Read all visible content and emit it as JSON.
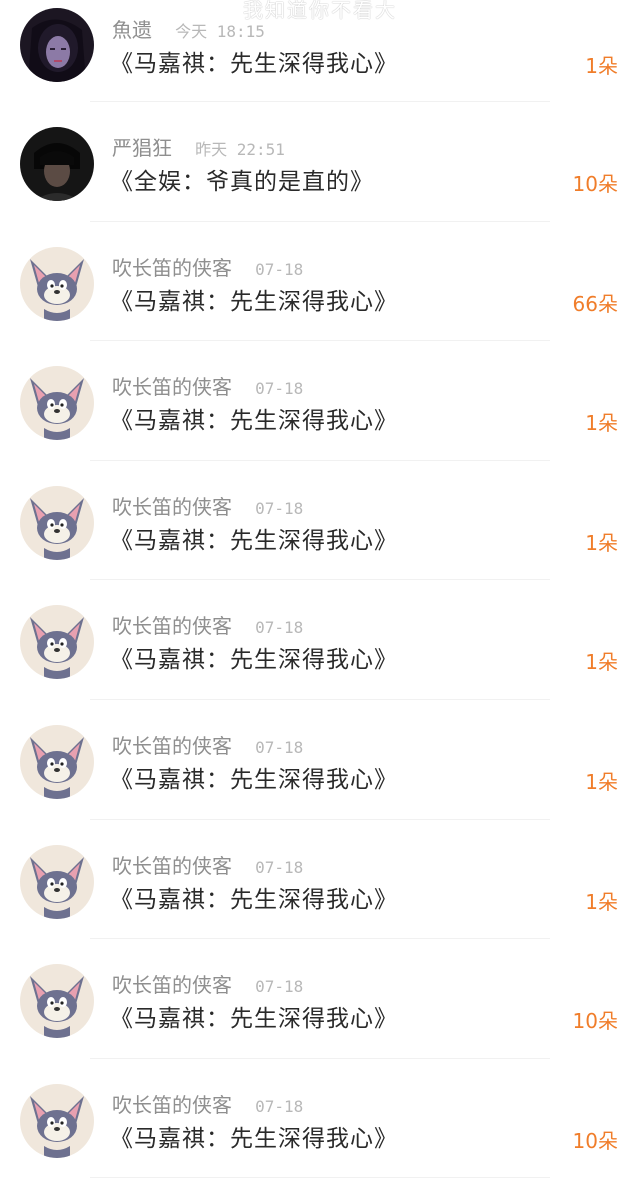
{
  "watermark": "我知道你不看大",
  "flower_unit": "朵",
  "items": [
    {
      "user": "魚遗",
      "time": "今天 18:15",
      "title": "《马嘉祺：先生深得我心》",
      "count": "1",
      "avatar": "dark-portrait-purple"
    },
    {
      "user": "严猖狂",
      "time": "昨天 22:51",
      "title": "《全娱：爷真的是直的》",
      "count": "10",
      "avatar": "dark-portrait"
    },
    {
      "user": "吹长笛的侠客",
      "time": "07-18",
      "title": "《马嘉祺：先生深得我心》",
      "count": "66",
      "avatar": "cartoon-cat"
    },
    {
      "user": "吹长笛的侠客",
      "time": "07-18",
      "title": "《马嘉祺：先生深得我心》",
      "count": "1",
      "avatar": "cartoon-cat"
    },
    {
      "user": "吹长笛的侠客",
      "time": "07-18",
      "title": "《马嘉祺：先生深得我心》",
      "count": "1",
      "avatar": "cartoon-cat"
    },
    {
      "user": "吹长笛的侠客",
      "time": "07-18",
      "title": "《马嘉祺：先生深得我心》",
      "count": "1",
      "avatar": "cartoon-cat"
    },
    {
      "user": "吹长笛的侠客",
      "time": "07-18",
      "title": "《马嘉祺：先生深得我心》",
      "count": "1",
      "avatar": "cartoon-cat"
    },
    {
      "user": "吹长笛的侠客",
      "time": "07-18",
      "title": "《马嘉祺：先生深得我心》",
      "count": "1",
      "avatar": "cartoon-cat"
    },
    {
      "user": "吹长笛的侠客",
      "time": "07-18",
      "title": "《马嘉祺：先生深得我心》",
      "count": "10",
      "avatar": "cartoon-cat"
    },
    {
      "user": "吹长笛的侠客",
      "time": "07-18",
      "title": "《马嘉祺：先生深得我心》",
      "count": "10",
      "avatar": "cartoon-cat"
    }
  ]
}
